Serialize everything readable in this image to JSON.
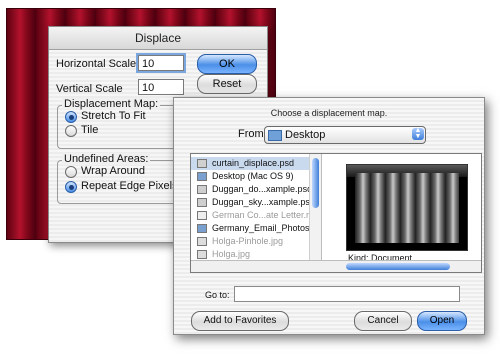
{
  "displace": {
    "title": "Displace",
    "horizontal_scale_label": "Horizontal Scale",
    "horizontal_scale_value": "10",
    "vertical_scale_label": "Vertical Scale",
    "vertical_scale_value": "10",
    "ok_label": "OK",
    "reset_label": "Reset",
    "displacement_map_title": "Displacement Map:",
    "stretch_label": "Stretch To Fit",
    "tile_label": "Tile",
    "undefined_areas_title": "Undefined Areas:",
    "wrap_label": "Wrap Around",
    "repeat_label": "Repeat Edge Pixels"
  },
  "chooser": {
    "heading": "Choose a displacement map.",
    "from_label": "From:",
    "from_value": "Desktop",
    "files": [
      {
        "name": "curtain_displace.psd",
        "selected": true,
        "dimmed": false,
        "arrow": false
      },
      {
        "name": "Desktop (Mac OS 9)",
        "selected": false,
        "dimmed": false,
        "arrow": true
      },
      {
        "name": "Duggan_do...xample.psd",
        "selected": false,
        "dimmed": false,
        "arrow": false
      },
      {
        "name": "Duggan_sky...xample.psd",
        "selected": false,
        "dimmed": false,
        "arrow": false
      },
      {
        "name": "German Co...ate Letter.rtf",
        "selected": false,
        "dimmed": true,
        "arrow": false
      },
      {
        "name": "Germany_Email_Photos",
        "selected": false,
        "dimmed": false,
        "arrow": true
      },
      {
        "name": "Holga-Pinhole.jpg",
        "selected": false,
        "dimmed": true,
        "arrow": false
      },
      {
        "name": "Holga.jpg",
        "selected": false,
        "dimmed": true,
        "arrow": false
      }
    ],
    "kind_label": "Kind: Document",
    "goto_label": "Go to:",
    "goto_value": "",
    "add_favorites_label": "Add to Favorites",
    "cancel_label": "Cancel",
    "open_label": "Open"
  },
  "colors": {
    "accent_blue": "#4a8fe8",
    "curtain_red": "#8a0b1f"
  }
}
